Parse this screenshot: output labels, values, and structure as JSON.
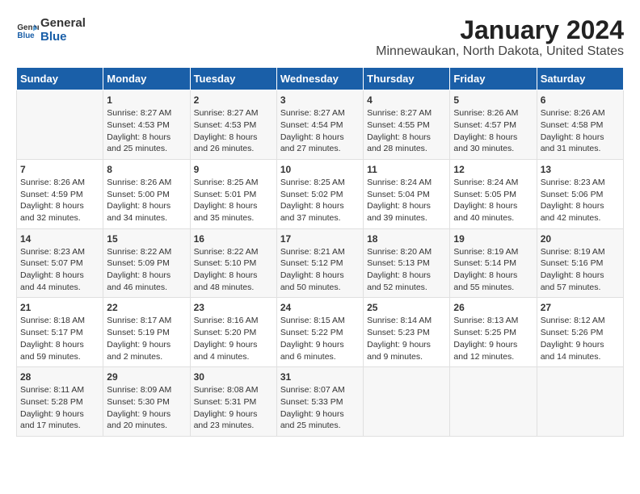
{
  "logo": {
    "line1": "General",
    "line2": "Blue"
  },
  "title": "January 2024",
  "subtitle": "Minnewaukan, North Dakota, United States",
  "days_of_week": [
    "Sunday",
    "Monday",
    "Tuesday",
    "Wednesday",
    "Thursday",
    "Friday",
    "Saturday"
  ],
  "weeks": [
    [
      {
        "day": "",
        "content": ""
      },
      {
        "day": "1",
        "content": "Sunrise: 8:27 AM\nSunset: 4:53 PM\nDaylight: 8 hours\nand 25 minutes."
      },
      {
        "day": "2",
        "content": "Sunrise: 8:27 AM\nSunset: 4:53 PM\nDaylight: 8 hours\nand 26 minutes."
      },
      {
        "day": "3",
        "content": "Sunrise: 8:27 AM\nSunset: 4:54 PM\nDaylight: 8 hours\nand 27 minutes."
      },
      {
        "day": "4",
        "content": "Sunrise: 8:27 AM\nSunset: 4:55 PM\nDaylight: 8 hours\nand 28 minutes."
      },
      {
        "day": "5",
        "content": "Sunrise: 8:26 AM\nSunset: 4:57 PM\nDaylight: 8 hours\nand 30 minutes."
      },
      {
        "day": "6",
        "content": "Sunrise: 8:26 AM\nSunset: 4:58 PM\nDaylight: 8 hours\nand 31 minutes."
      }
    ],
    [
      {
        "day": "7",
        "content": "Sunrise: 8:26 AM\nSunset: 4:59 PM\nDaylight: 8 hours\nand 32 minutes."
      },
      {
        "day": "8",
        "content": "Sunrise: 8:26 AM\nSunset: 5:00 PM\nDaylight: 8 hours\nand 34 minutes."
      },
      {
        "day": "9",
        "content": "Sunrise: 8:25 AM\nSunset: 5:01 PM\nDaylight: 8 hours\nand 35 minutes."
      },
      {
        "day": "10",
        "content": "Sunrise: 8:25 AM\nSunset: 5:02 PM\nDaylight: 8 hours\nand 37 minutes."
      },
      {
        "day": "11",
        "content": "Sunrise: 8:24 AM\nSunset: 5:04 PM\nDaylight: 8 hours\nand 39 minutes."
      },
      {
        "day": "12",
        "content": "Sunrise: 8:24 AM\nSunset: 5:05 PM\nDaylight: 8 hours\nand 40 minutes."
      },
      {
        "day": "13",
        "content": "Sunrise: 8:23 AM\nSunset: 5:06 PM\nDaylight: 8 hours\nand 42 minutes."
      }
    ],
    [
      {
        "day": "14",
        "content": "Sunrise: 8:23 AM\nSunset: 5:07 PM\nDaylight: 8 hours\nand 44 minutes."
      },
      {
        "day": "15",
        "content": "Sunrise: 8:22 AM\nSunset: 5:09 PM\nDaylight: 8 hours\nand 46 minutes."
      },
      {
        "day": "16",
        "content": "Sunrise: 8:22 AM\nSunset: 5:10 PM\nDaylight: 8 hours\nand 48 minutes."
      },
      {
        "day": "17",
        "content": "Sunrise: 8:21 AM\nSunset: 5:12 PM\nDaylight: 8 hours\nand 50 minutes."
      },
      {
        "day": "18",
        "content": "Sunrise: 8:20 AM\nSunset: 5:13 PM\nDaylight: 8 hours\nand 52 minutes."
      },
      {
        "day": "19",
        "content": "Sunrise: 8:19 AM\nSunset: 5:14 PM\nDaylight: 8 hours\nand 55 minutes."
      },
      {
        "day": "20",
        "content": "Sunrise: 8:19 AM\nSunset: 5:16 PM\nDaylight: 8 hours\nand 57 minutes."
      }
    ],
    [
      {
        "day": "21",
        "content": "Sunrise: 8:18 AM\nSunset: 5:17 PM\nDaylight: 8 hours\nand 59 minutes."
      },
      {
        "day": "22",
        "content": "Sunrise: 8:17 AM\nSunset: 5:19 PM\nDaylight: 9 hours\nand 2 minutes."
      },
      {
        "day": "23",
        "content": "Sunrise: 8:16 AM\nSunset: 5:20 PM\nDaylight: 9 hours\nand 4 minutes."
      },
      {
        "day": "24",
        "content": "Sunrise: 8:15 AM\nSunset: 5:22 PM\nDaylight: 9 hours\nand 6 minutes."
      },
      {
        "day": "25",
        "content": "Sunrise: 8:14 AM\nSunset: 5:23 PM\nDaylight: 9 hours\nand 9 minutes."
      },
      {
        "day": "26",
        "content": "Sunrise: 8:13 AM\nSunset: 5:25 PM\nDaylight: 9 hours\nand 12 minutes."
      },
      {
        "day": "27",
        "content": "Sunrise: 8:12 AM\nSunset: 5:26 PM\nDaylight: 9 hours\nand 14 minutes."
      }
    ],
    [
      {
        "day": "28",
        "content": "Sunrise: 8:11 AM\nSunset: 5:28 PM\nDaylight: 9 hours\nand 17 minutes."
      },
      {
        "day": "29",
        "content": "Sunrise: 8:09 AM\nSunset: 5:30 PM\nDaylight: 9 hours\nand 20 minutes."
      },
      {
        "day": "30",
        "content": "Sunrise: 8:08 AM\nSunset: 5:31 PM\nDaylight: 9 hours\nand 23 minutes."
      },
      {
        "day": "31",
        "content": "Sunrise: 8:07 AM\nSunset: 5:33 PM\nDaylight: 9 hours\nand 25 minutes."
      },
      {
        "day": "",
        "content": ""
      },
      {
        "day": "",
        "content": ""
      },
      {
        "day": "",
        "content": ""
      }
    ]
  ]
}
